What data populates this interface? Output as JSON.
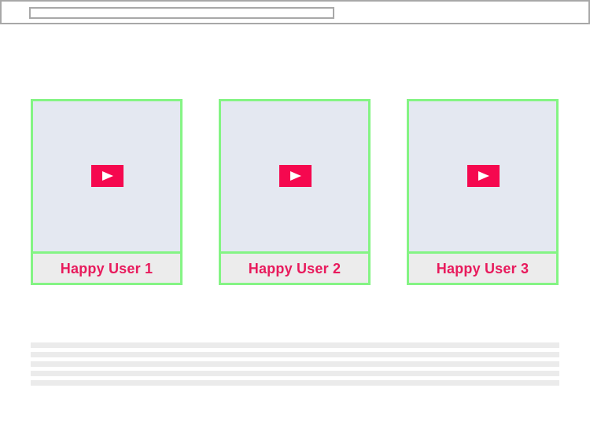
{
  "header": {
    "address_value": ""
  },
  "testimonials": [
    {
      "caption": "Happy User 1",
      "play_icon": "play-icon"
    },
    {
      "caption": "Happy User 2",
      "play_icon": "play-icon"
    },
    {
      "caption": "Happy User 3",
      "play_icon": "play-icon"
    }
  ],
  "colors": {
    "card_border": "#84f484",
    "thumbnail": "#e4e8f1",
    "play_button": "#f5084f",
    "caption_text": "#e81a5c",
    "caption_background": "#ececec",
    "placeholder_lines": "#ebebeb",
    "browser_border": "#a8a8a8"
  }
}
